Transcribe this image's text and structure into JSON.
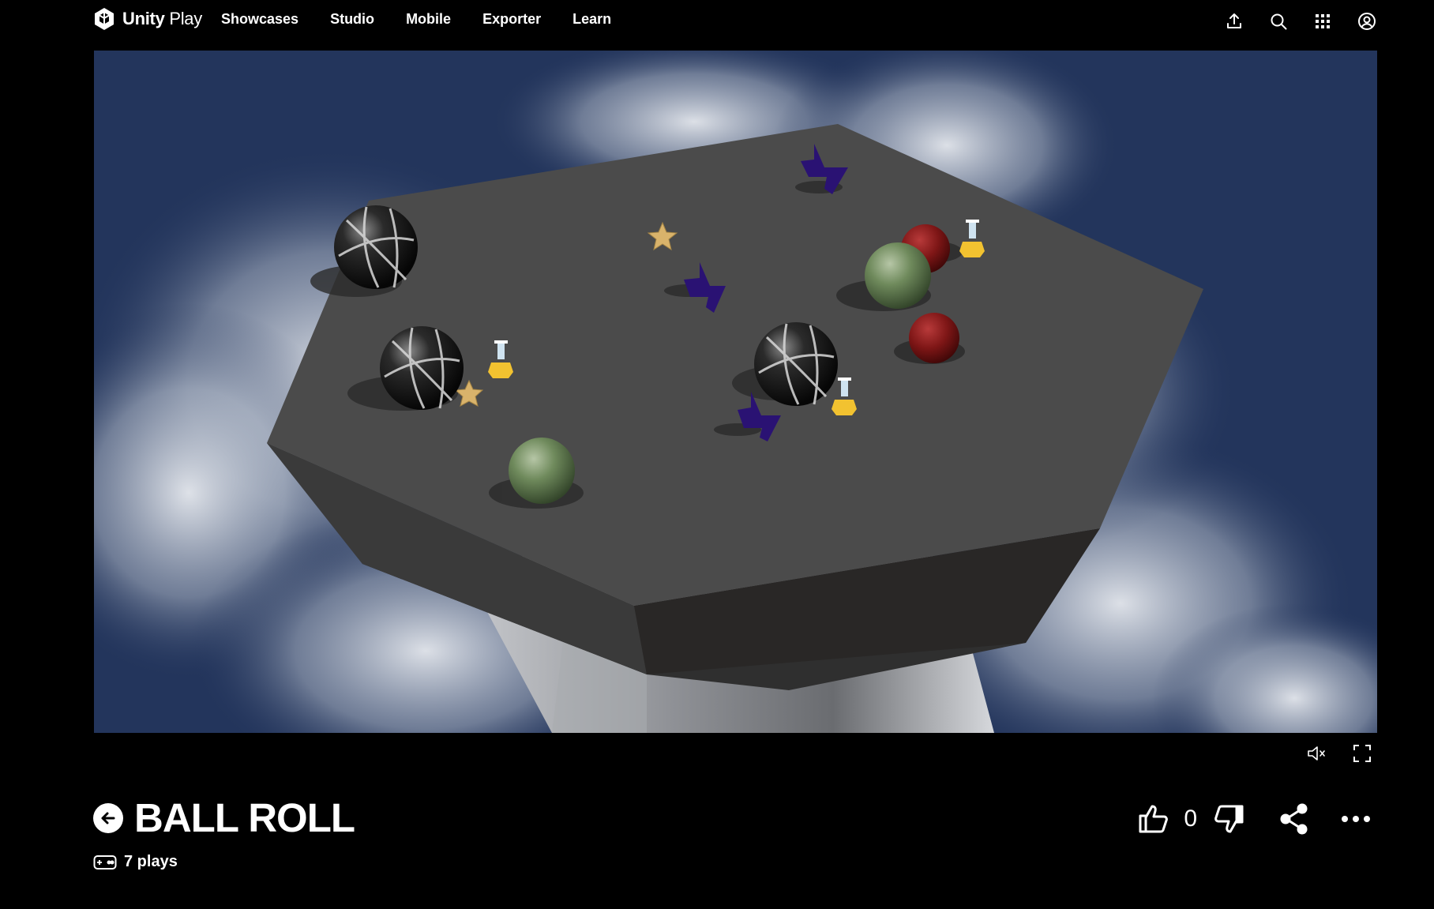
{
  "nav": {
    "brand_bold": "Unity",
    "brand_light": "Play",
    "links": [
      "Showcases",
      "Studio",
      "Mobile",
      "Exporter",
      "Learn"
    ],
    "icons": [
      "upload-icon",
      "search-icon",
      "apps-grid-icon",
      "account-icon"
    ]
  },
  "player": {
    "mute_icon": "mute-icon",
    "fullscreen_icon": "fullscreen-icon"
  },
  "game": {
    "title": "BALL ROLL",
    "plays": "7 plays",
    "like_count": "0"
  },
  "colors": {
    "background": "#000000",
    "text": "#ffffff",
    "sky_dark": "#1e3058",
    "platform_top": "#4a4a4a"
  }
}
